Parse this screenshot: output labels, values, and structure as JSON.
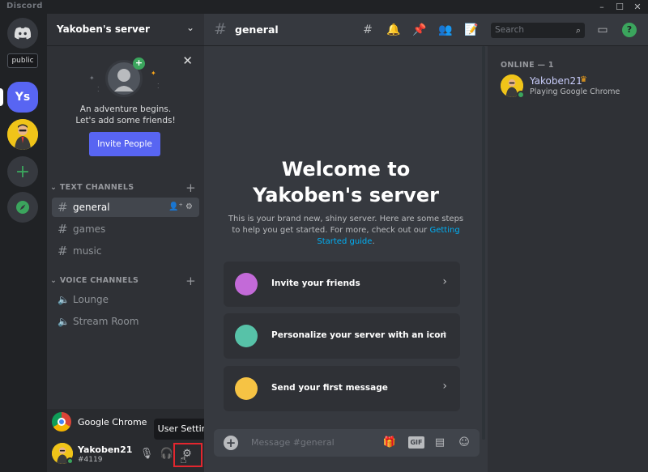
{
  "window": {
    "brand": "Discord",
    "controls": [
      "–",
      "☐",
      "✕"
    ]
  },
  "rail": {
    "tooltip": "public",
    "active_server_initials": "Ys"
  },
  "server": {
    "name": "Yakoben's server"
  },
  "invite_card": {
    "text_line1": "An adventure begins.",
    "text_line2": "Let's add some friends!",
    "button": "Invite People"
  },
  "text_category": {
    "label": "TEXT CHANNELS",
    "channels": [
      "general",
      "games",
      "music"
    ]
  },
  "voice_category": {
    "label": "VOICE CHANNELS",
    "channels": [
      "Lounge",
      "Stream Room"
    ]
  },
  "activity": {
    "label": "Google Chrome"
  },
  "user": {
    "name": "Yakoben21",
    "tag": "#4119",
    "settings_tooltip": "User Settings"
  },
  "channel_header": {
    "name": "general",
    "search_placeholder": "Search"
  },
  "welcome": {
    "title_line1": "Welcome to",
    "title_line2": "Yakoben's server",
    "desc_part1": "This is your brand new, shiny server. Here are some steps to help you get started. For more, check out our ",
    "desc_link": "Getting Started guide",
    "desc_part2": "."
  },
  "actions": [
    {
      "label": "Invite your friends",
      "icon_color": "#c36ad8"
    },
    {
      "label": "Personalize your server with an icon",
      "icon_color": "#57c2a8"
    },
    {
      "label": "Send your first message",
      "icon_color": "#f6c344"
    }
  ],
  "composer": {
    "placeholder": "Message #general",
    "gif_label": "GIF"
  },
  "members": {
    "header": "ONLINE — 1",
    "list": [
      {
        "name": "Yakoben21",
        "activity_prefix": "Playing",
        "activity": "Google Chrome"
      }
    ]
  },
  "colors": {
    "blurple": "#5865f2",
    "online": "#3ba55d",
    "highlight_box": "#e3262e",
    "link": "#00aff4"
  }
}
